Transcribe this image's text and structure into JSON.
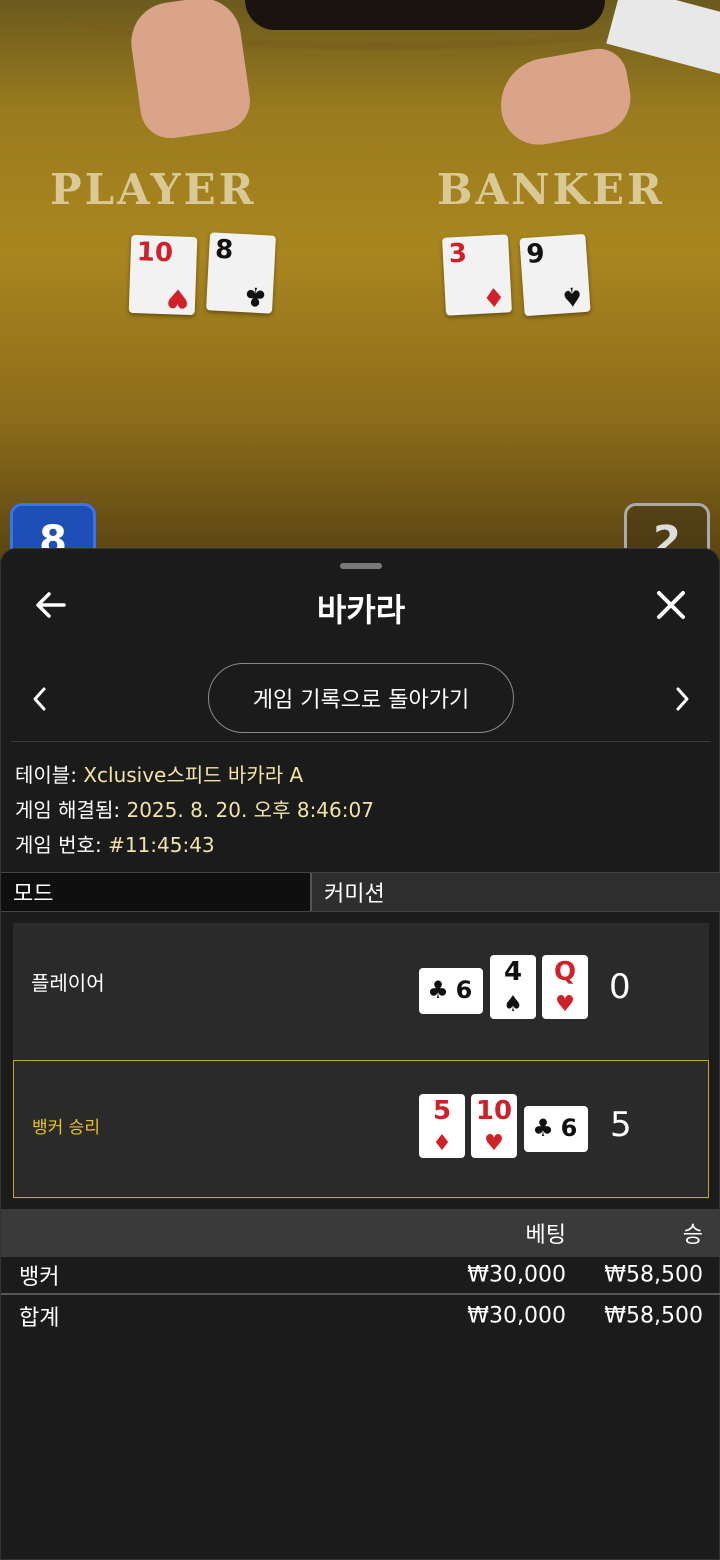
{
  "video": {
    "player_label": "PLAYER",
    "banker_label": "BANKER",
    "table_cards": [
      {
        "rank": "10",
        "suit": "♥",
        "color": "red"
      },
      {
        "rank": "8",
        "suit": "♣",
        "color": "black"
      },
      {
        "rank": "3",
        "suit": "♦",
        "color": "red"
      },
      {
        "rank": "9",
        "suit": "♠",
        "color": "black"
      }
    ],
    "player_score_chip": "8",
    "banker_score_chip": "2"
  },
  "sheet": {
    "title": "바카라",
    "history_button": "게임 기록으로 돌아가기",
    "info": {
      "table_label": "테이블:",
      "table_value": "Xclusive스피드 바카라 A",
      "resolved_label": "게임 해결됨:",
      "resolved_value": "2025. 8. 20. 오후 8:46:07",
      "game_no_label": "게임 번호:",
      "game_no_value": "#11:45:43"
    },
    "tabs": {
      "mode": "모드",
      "commission": "커미션"
    },
    "result": {
      "player": {
        "label": "플레이어",
        "score": "0",
        "cards": [
          {
            "rank": "6",
            "suit": "♣",
            "color": "black"
          },
          {
            "rank": "4",
            "suit": "♠",
            "color": "black"
          },
          {
            "rank": "Q",
            "suit": "♥",
            "color": "red"
          }
        ]
      },
      "banker": {
        "label": "뱅커 승리",
        "score": "5",
        "cards": [
          {
            "rank": "5",
            "suit": "♦",
            "color": "red"
          },
          {
            "rank": "10",
            "suit": "♥",
            "color": "red"
          },
          {
            "rank": "6",
            "suit": "♣",
            "color": "black"
          }
        ]
      }
    },
    "bets": {
      "header_bet": "베팅",
      "header_win": "승",
      "rows": [
        {
          "label": "뱅커",
          "bet": "₩30,000",
          "win": "₩58,500"
        },
        {
          "label": "합계",
          "bet": "₩30,000",
          "win": "₩58,500"
        }
      ]
    }
  },
  "colors": {
    "accent_gold": "#c9a818",
    "info_value": "#f2e3a6",
    "card_red": "#d0202a",
    "chip_player": "#1e4fb6"
  }
}
